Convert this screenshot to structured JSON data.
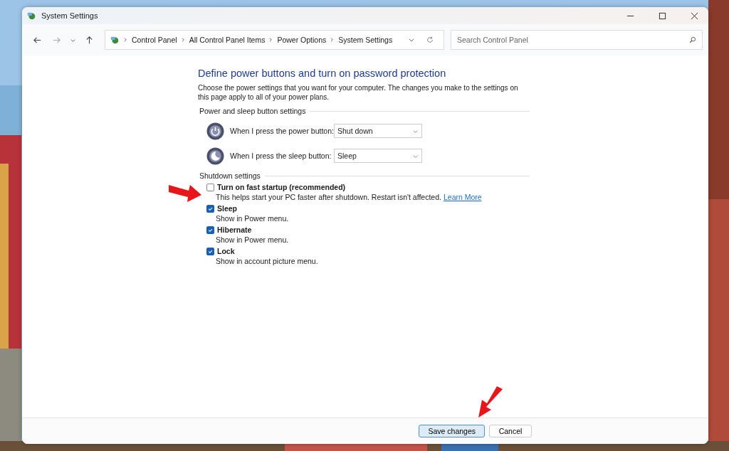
{
  "window": {
    "title": "System Settings"
  },
  "breadcrumb": [
    "Control Panel",
    "All Control Panel Items",
    "Power Options",
    "System Settings"
  ],
  "search": {
    "placeholder": "Search Control Panel"
  },
  "heading": "Define power buttons and turn on password protection",
  "intro": "Choose the power settings that you want for your computer. The changes you make to the settings on this page apply to all of your power plans.",
  "button_section": {
    "title": "Power and sleep button settings",
    "rows": [
      {
        "kind": "power",
        "label": "When I press the power button:",
        "value": "Shut down"
      },
      {
        "kind": "sleep",
        "label": "When I press the sleep button:",
        "value": "Sleep"
      }
    ]
  },
  "shutdown_section": {
    "title": "Shutdown settings",
    "options": [
      {
        "label": "Turn on fast startup (recommended)",
        "checked": false,
        "description": "This helps start your PC faster after shutdown. Restart isn't affected.",
        "link": "Learn More"
      },
      {
        "label": "Sleep",
        "checked": true,
        "description": "Show in Power menu."
      },
      {
        "label": "Hibernate",
        "checked": true,
        "description": "Show in Power menu."
      },
      {
        "label": "Lock",
        "checked": true,
        "description": "Show in account picture menu."
      }
    ]
  },
  "buttons": [
    {
      "label": "Save changes",
      "kind": "primary"
    },
    {
      "label": "Cancel",
      "kind": "secondary"
    }
  ]
}
